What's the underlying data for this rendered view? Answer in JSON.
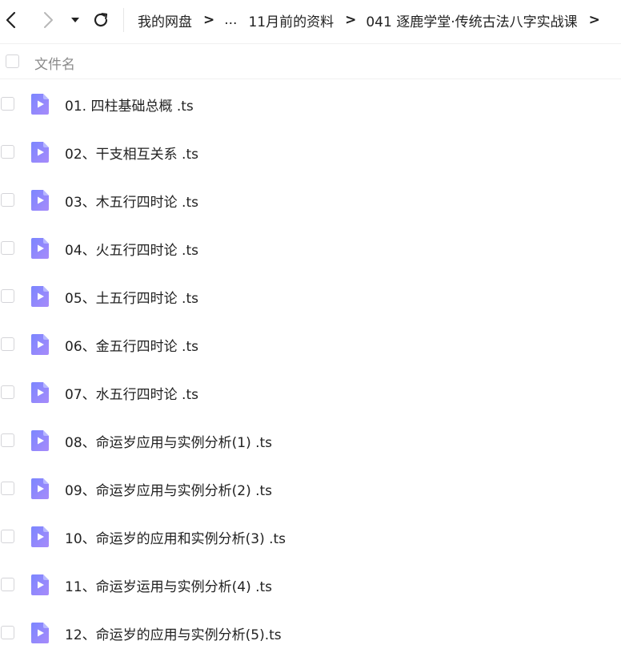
{
  "toolbar": {
    "back_icon": "chevron-left-icon",
    "forward_icon": "chevron-right-icon",
    "dropdown_icon": "caret-down-icon",
    "refresh_icon": "refresh-icon"
  },
  "breadcrumb": {
    "items": [
      "我的网盘",
      "...",
      "11月前的资料",
      "041 逐鹿学堂·传统古法八字实战课"
    ],
    "separator": ">"
  },
  "table": {
    "column_name": "文件名"
  },
  "files": [
    {
      "name": "01. 四柱基础总概 .ts",
      "icon": "video-file-icon"
    },
    {
      "name": "02、干支相互关系 .ts",
      "icon": "video-file-icon"
    },
    {
      "name": "03、木五行四时论 .ts",
      "icon": "video-file-icon"
    },
    {
      "name": "04、火五行四时论 .ts",
      "icon": "video-file-icon"
    },
    {
      "name": "05、土五行四时论 .ts",
      "icon": "video-file-icon"
    },
    {
      "name": "06、金五行四时论 .ts",
      "icon": "video-file-icon"
    },
    {
      "name": "07、水五行四时论 .ts",
      "icon": "video-file-icon"
    },
    {
      "name": "08、命运岁应用与实例分析(1) .ts",
      "icon": "video-file-icon"
    },
    {
      "name": "09、命运岁应用与实例分析(2) .ts",
      "icon": "video-file-icon"
    },
    {
      "name": "10、命运岁的应用和实例分析(3) .ts",
      "icon": "video-file-icon"
    },
    {
      "name": "11、命运岁运用与实例分析(4) .ts",
      "icon": "video-file-icon"
    },
    {
      "name": "12、命运岁的应用与实例分析(5).ts",
      "icon": "video-file-icon"
    }
  ],
  "colors": {
    "video_icon_top": "#7b86ff",
    "video_icon_bottom": "#a78bfa"
  }
}
